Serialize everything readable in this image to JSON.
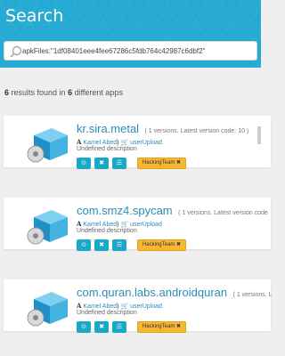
{
  "header": {
    "title": "Search"
  },
  "search": {
    "value": "apkFiles:\"1df08401eee4fee67286c5fdb764c42987c6dbf2\""
  },
  "summary": {
    "count": "6",
    "text_mid": " results found in ",
    "apps": "6",
    "text_end": " different apps"
  },
  "results": [
    {
      "name": "kr.sira.metal",
      "meta": "( 1 versions. Latest version code: 10 )",
      "developer": "Kamel Abed",
      "uploader": "userUpload",
      "description": "Undefined description",
      "tag": "HackingTeam ✖"
    },
    {
      "name": "com.smz4.spycam",
      "meta": "( 1 versions. Latest version code",
      "developer": "Kamel Abed",
      "uploader": "userUpload",
      "description": "Undefined description",
      "tag": "HackingTeam ✖"
    },
    {
      "name": "com.quran.labs.androidquran",
      "meta": "( 1 versions. L",
      "developer": "Kamel Abed",
      "uploader": "userUpload",
      "description": "Undefined description",
      "tag": "HackingTeam ✖"
    }
  ],
  "icons": {
    "search": "search-icon",
    "developer": "developer-icon",
    "uploader": "cart-icon",
    "info": "info-icon",
    "remove": "close-icon",
    "compare": "equals-icon",
    "package": "package-box-icon"
  },
  "colors": {
    "header": "#25aad3",
    "link": "#2a8cba",
    "button": "#1aa8c8",
    "tag": "#f7b731"
  }
}
